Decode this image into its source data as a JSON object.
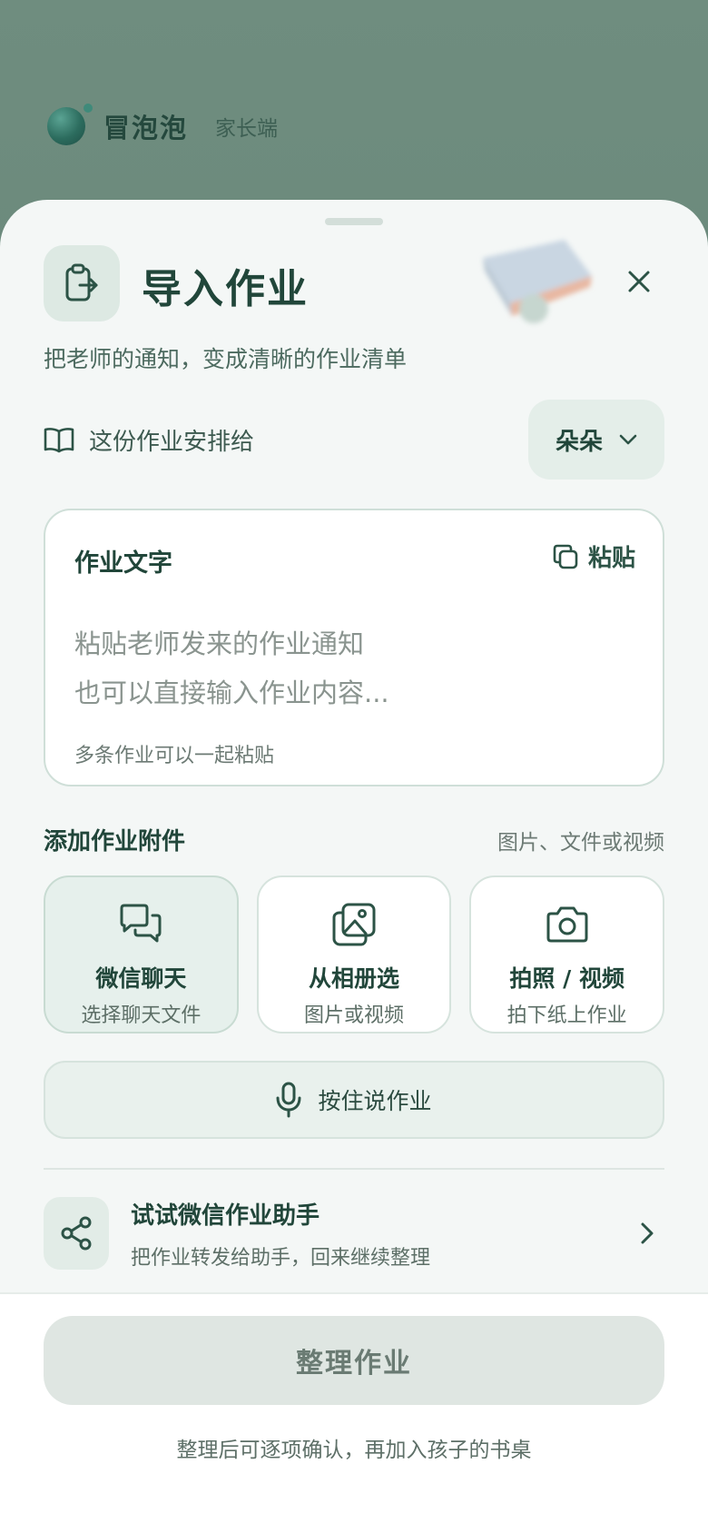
{
  "app": {
    "name": "冒泡泡",
    "role": "家长端"
  },
  "sheet": {
    "title": "导入作业",
    "subtitle": "把老师的通知，变成清晰的作业清单"
  },
  "assign": {
    "label": "这份作业安排给",
    "child": "朵朵"
  },
  "text_card": {
    "title": "作业文字",
    "paste_label": "粘贴",
    "placeholder": "粘贴老师发来的作业通知\n也可以直接输入作业内容...",
    "hint": "多条作业可以一起粘贴"
  },
  "attachments": {
    "title": "添加作业附件",
    "subtitle": "图片、文件或视频",
    "tiles": [
      {
        "title": "微信聊天",
        "sub": "选择聊天文件",
        "icon": "chat-icon"
      },
      {
        "title": "从相册选",
        "sub": "图片或视频",
        "icon": "gallery-icon"
      },
      {
        "title": "拍照 / 视频",
        "sub": "拍下纸上作业",
        "icon": "camera-icon"
      }
    ]
  },
  "voice": {
    "label": "按住说作业"
  },
  "assistant": {
    "title": "试试微信作业助手",
    "sub": "把作业转发给助手，回来继续整理"
  },
  "footer": {
    "button": "整理作业",
    "note": "整理后可逐项确认，再加入孩子的书桌"
  },
  "colors": {
    "accent": "#2c5346",
    "sheet_bg": "#f4f7f6",
    "backdrop": "#6f8d7f"
  }
}
